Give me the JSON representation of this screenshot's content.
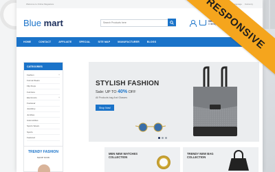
{
  "topbar": {
    "welcome": "Welcome to Online Megastore",
    "language": "Language",
    "currency": "Currency"
  },
  "header": {
    "logo_light": "Blue",
    "logo_bold": "mart",
    "search_placeholder": "Search Products here",
    "cart_label": "SHOPPING",
    "cart_summary": "0 item(s) - $0.00"
  },
  "nav": {
    "items": [
      "HOME",
      "CONTACT",
      "AFFILIATE",
      "SPECIAL",
      "SITE MAP",
      "MANUFACTURER",
      "BLOGS"
    ]
  },
  "sidebar": {
    "title": "CATEGORIES",
    "items": [
      {
        "label": "Fashion",
        "expandable": true
      },
      {
        "label": "Formal Wears",
        "expandable": false
      },
      {
        "label": "Flip Flops",
        "expandable": false
      },
      {
        "label": "Furniture",
        "expandable": false
      },
      {
        "label": "Electronics",
        "expandable": true
      },
      {
        "label": "Footwear",
        "expandable": false
      },
      {
        "label": "Jewellery",
        "expandable": false
      },
      {
        "label": "Jumbles",
        "expandable": false
      },
      {
        "label": "Automobiles",
        "expandable": false
      },
      {
        "label": "Sports Wears",
        "expandable": false
      },
      {
        "label": "Sports",
        "expandable": false
      },
      {
        "label": "Featured",
        "expandable": false
      }
    ]
  },
  "banner": {
    "title": "STYLISH FASHION",
    "sale_prefix": "Sale: UP TO",
    "sale_percent": "40%",
    "sale_suffix": "OFF",
    "subtitle": "All Products bag And Glasses",
    "button": "Shop Now!",
    "slide_count": 3,
    "active_slide": 1
  },
  "promos": {
    "left_title": "TRENDY FASHION",
    "left_link": "SHOP NOW",
    "watches": "MEN NEW WATCHES COLLECTION",
    "bags": "TRENDY NEW BAG COLLECTION"
  },
  "ribbon": {
    "label": "RESPONSIVE"
  },
  "colors": {
    "brand_blue": "#1a73c9",
    "ribbon": "#f5a51d",
    "navy": "#1a2d5a"
  }
}
